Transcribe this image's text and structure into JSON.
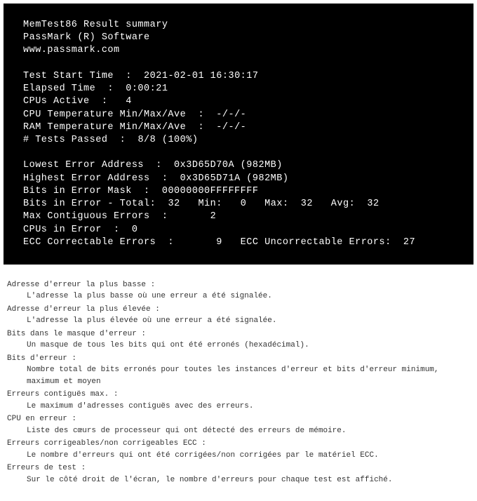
{
  "terminal": {
    "title": "MemTest86 Result summary",
    "vendor": "PassMark (R) Software",
    "url": "www.passmark.com",
    "labels": {
      "test_start": "Test Start Time",
      "elapsed": "Elapsed Time",
      "cpus_active": "CPUs Active",
      "cpu_temp": "CPU Temperature Min/Max/Ave",
      "ram_temp": "RAM Temperature Min/Max/Ave",
      "tests_passed": "# Tests Passed",
      "lowest_err": "Lowest Error Address",
      "highest_err": "Highest Error Address",
      "bits_mask": "Bits in Error Mask",
      "bits_in_error": "Bits in Error",
      "bits_total": "Total",
      "bits_min": "Min",
      "bits_max": "Max",
      "bits_avg": "Avg",
      "max_contig": "Max Contiguous Errors",
      "cpus_err": "CPUs in Error",
      "ecc_corr": "ECC Correctable Errors",
      "ecc_uncorr": "ECC Uncorrectable Errors"
    },
    "values": {
      "test_start": "2021-02-01 16:30:17",
      "elapsed": "0:00:21",
      "cpus_active": "4",
      "cpu_temp": "-/-/-",
      "ram_temp": "-/-/-",
      "tests_passed": "8/8 (100%)",
      "lowest_err": "0x3D65D70A (982MB)",
      "highest_err": "0x3D65D71A (982MB)",
      "bits_mask": "00000000FFFFFFFF",
      "bits_total": "32",
      "bits_min": "0",
      "bits_max": "32",
      "bits_avg": "32",
      "max_contig": "2",
      "cpus_err": "0",
      "ecc_corr": "9",
      "ecc_uncorr": "27"
    }
  },
  "definitions": [
    {
      "term": "Adresse d'erreur la plus basse :",
      "desc": "L'adresse la plus basse où une erreur a été signalée."
    },
    {
      "term": "Adresse d'erreur la plus élevée :",
      "desc": "L'adresse la plus élevée où une erreur a été signalée."
    },
    {
      "term": "Bits dans le masque d'erreur :",
      "desc": "Un masque de tous les bits qui ont été erronés (hexadécimal)."
    },
    {
      "term": "Bits d'erreur :",
      "desc": "Nombre total de bits erronés pour toutes les instances d'erreur et bits d'erreur minimum, maximum et moyen"
    },
    {
      "term": "Erreurs contiguës max. :",
      "desc": "Le maximum d'adresses contiguës avec des erreurs."
    },
    {
      "term": "CPU en erreur :",
      "desc": "Liste des cœurs de processeur qui ont détecté des erreurs de mémoire."
    },
    {
      "term": "Erreurs corrigeables/non corrigeables ECC :",
      "desc": "Le nombre d'erreurs qui ont été corrigées/non corrigées par le matériel ECC."
    },
    {
      "term": "Erreurs de test :",
      "desc": "Sur le côté droit de l'écran, le nombre d'erreurs pour chaque test est affiché."
    }
  ]
}
